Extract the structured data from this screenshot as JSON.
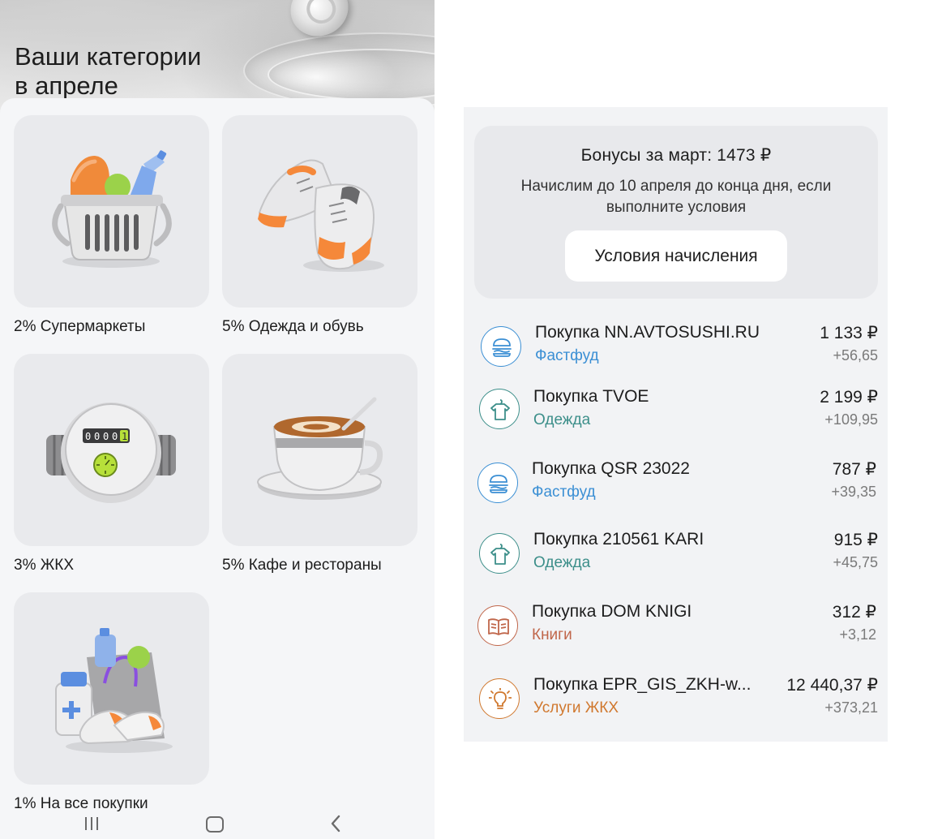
{
  "left": {
    "title_line1": "Ваши категории",
    "title_line2": "в апреле",
    "categories": [
      {
        "label": "2% Супермаркеты",
        "icon": "grocery-basket-icon"
      },
      {
        "label": "5% Одежда и обувь",
        "icon": "sneakers-icon"
      },
      {
        "label": "3% ЖКХ",
        "icon": "water-meter-icon",
        "meter_reading": "0000"
      },
      {
        "label": "5% Кафе и рестораны",
        "icon": "coffee-cup-icon"
      },
      {
        "label": "1% На все покупки",
        "icon": "shopping-bag-icon"
      }
    ],
    "meter_digits": [
      "0",
      "0",
      "0",
      "0",
      "1"
    ]
  },
  "nav": {
    "recent_icon": "recent-apps-icon",
    "home_icon": "home-icon",
    "back_icon": "back-icon"
  },
  "right": {
    "bonus": {
      "title": "Бонусы за март: 1473 ₽",
      "description": "Начислим до 10 апреля до конца дня, если выполните условия",
      "button_label": "Условия начисления"
    },
    "transactions": [
      {
        "name": "Покупка NN.AVTOSUSHI.RU",
        "category": "Фастфуд",
        "amount": "1 133 ₽",
        "bonus": "+56,65",
        "icon": "burger-icon",
        "color": "#3b8fd4"
      },
      {
        "name": "Покупка TVOE",
        "category": "Одежда",
        "amount": "2 199 ₽",
        "bonus": "+109,95",
        "icon": "tshirt-icon",
        "color": "#3d8f8a"
      },
      {
        "name": "Покупка QSR 23022",
        "category": "Фастфуд",
        "amount": "787 ₽",
        "bonus": "+39,35",
        "icon": "burger-icon",
        "color": "#3b8fd4"
      },
      {
        "name": "Покупка 210561 KARI",
        "category": "Одежда",
        "amount": "915 ₽",
        "bonus": "+45,75",
        "icon": "tshirt-icon",
        "color": "#3d8f8a"
      },
      {
        "name": "Покупка DOM KNIGI",
        "category": "Книги",
        "amount": "312 ₽",
        "bonus": "+3,12",
        "icon": "book-icon",
        "color": "#c0664a"
      },
      {
        "name": "Покупка EPR_GIS_ZKH-w...",
        "category": "Услуги ЖКХ",
        "amount": "12 440,37 ₽",
        "bonus": "+373,21",
        "icon": "lightbulb-icon",
        "color": "#d0782e"
      }
    ]
  }
}
